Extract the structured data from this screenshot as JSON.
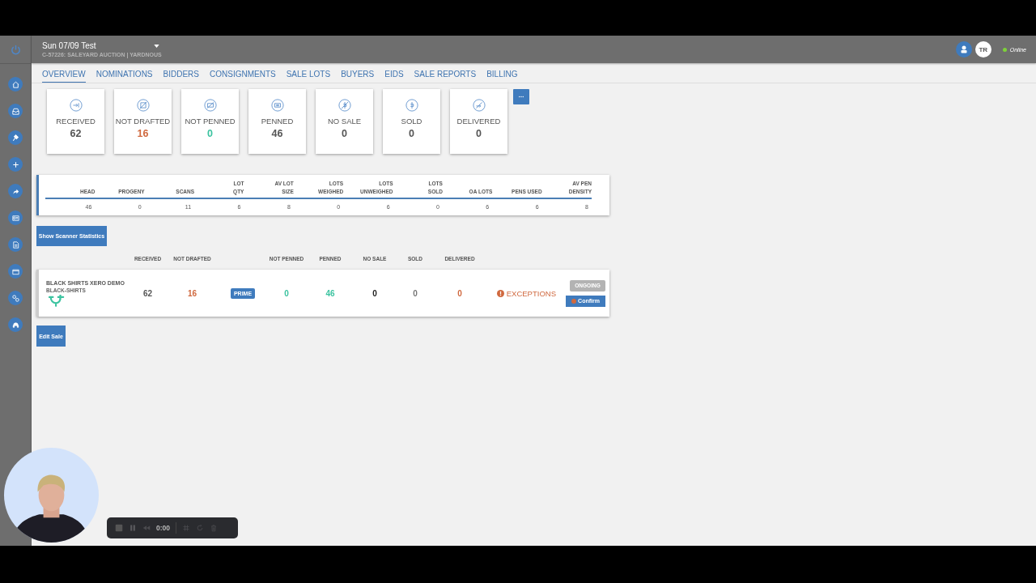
{
  "header": {
    "title": "Sun 07/09 Test",
    "subtitle": "C-57226: SALEYARD AUCTION | YARDNOUS",
    "user_initials": "TR",
    "status": "Online",
    "online": true
  },
  "tabs": [
    {
      "label": "OVERVIEW",
      "selected": true
    },
    {
      "label": "NOMINATIONS",
      "selected": false
    },
    {
      "label": "BIDDERS",
      "selected": false
    },
    {
      "label": "CONSIGNMENTS",
      "selected": false
    },
    {
      "label": "SALE LOTS",
      "selected": false
    },
    {
      "label": "BUYERS",
      "selected": false
    },
    {
      "label": "EIDS",
      "selected": false
    },
    {
      "label": "SALE REPORTS",
      "selected": false
    },
    {
      "label": "BILLING",
      "selected": false
    }
  ],
  "stat_cards": [
    {
      "label": "RECEIVED",
      "value": "62",
      "color": "#555555"
    },
    {
      "label": "NOT DRAFTED",
      "value": "16",
      "color": "#d0693f"
    },
    {
      "label": "NOT PENNED",
      "value": "0",
      "color": "#3cc3a0"
    },
    {
      "label": "PENNED",
      "value": "46",
      "color": "#555555"
    },
    {
      "label": "NO SALE",
      "value": "0",
      "color": "#555555"
    },
    {
      "label": "SOLD",
      "value": "0",
      "color": "#555555"
    },
    {
      "label": "DELIVERED",
      "value": "0",
      "color": "#555555"
    }
  ],
  "summary": {
    "columns": [
      {
        "lines": [
          "HEAD"
        ],
        "value": "46"
      },
      {
        "lines": [
          "PROGENY"
        ],
        "value": "0"
      },
      {
        "lines": [
          "SCANS"
        ],
        "value": "11"
      },
      {
        "lines": [
          "LOT",
          "QTY"
        ],
        "value": "6"
      },
      {
        "lines": [
          "AV LOT",
          "SIZE"
        ],
        "value": "8"
      },
      {
        "lines": [
          "LOTS",
          "WEIGHED"
        ],
        "value": "0"
      },
      {
        "lines": [
          "LOTS",
          "UNWEIGHED"
        ],
        "value": "6"
      },
      {
        "lines": [
          "LOTS",
          "SOLD"
        ],
        "value": "0"
      },
      {
        "lines": [
          "OA LOTS"
        ],
        "value": "6"
      },
      {
        "lines": [
          "PENS USED"
        ],
        "value": "6"
      },
      {
        "lines": [
          "AV PEN",
          "DENSITY"
        ],
        "value": "8"
      }
    ]
  },
  "scanner_button": "Show Scanner Statistics",
  "consignments": {
    "columns": [
      "RECEIVED",
      "NOT DRAFTED",
      "NOT PENNED",
      "PENNED",
      "NO SALE",
      "SOLD",
      "DELIVERED"
    ],
    "rows": [
      {
        "name": "BLACK SHIRTS XERO DEMO",
        "code": "BLACK-SHIRTS",
        "prime": "PRIME",
        "values": [
          {
            "text": "62",
            "color": "#555555"
          },
          {
            "text": "16",
            "color": "#d0693f"
          },
          {
            "text": "0",
            "color": "#3cc3a0"
          },
          {
            "text": "46",
            "color": "#3cc3a0"
          },
          {
            "text": "0",
            "color": "#222222"
          },
          {
            "text": "0",
            "color": "#777777"
          },
          {
            "text": "0",
            "color": "#d0693f"
          }
        ],
        "exceptions": "EXCEPTIONS",
        "status": "ONGOING",
        "confirm": "Confirm"
      }
    ]
  },
  "edit_button": "Edit Sale",
  "recorder": {
    "time": "0:00"
  }
}
